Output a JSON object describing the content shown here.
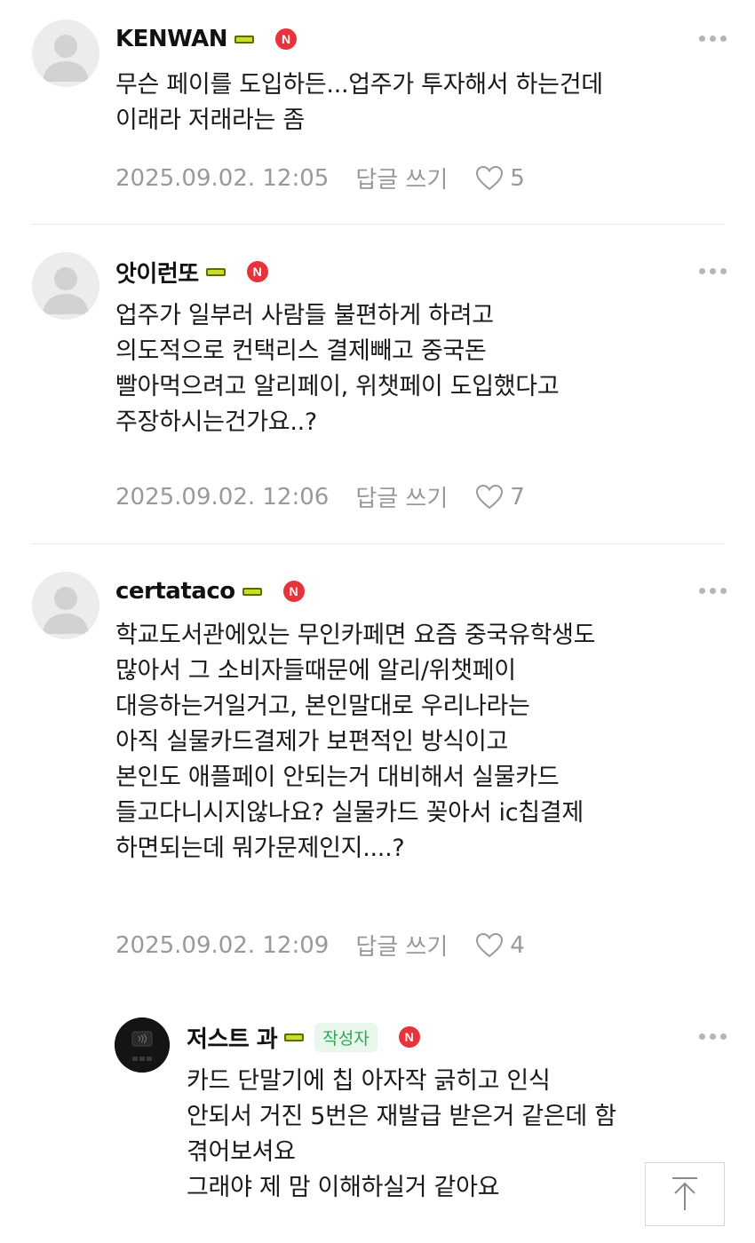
{
  "comments": [
    {
      "author": "KENWAN",
      "badge_letter": "N",
      "text": "무슨 페이를 도입하든...업주가 투자해서 하는건데\n이래라 저래라는 좀",
      "date": "2025.09.02. 12:05",
      "reply_label": "답글 쓰기",
      "likes": "5"
    },
    {
      "author": "앗이런또",
      "badge_letter": "N",
      "text": "업주가 일부러 사람들 불편하게 하려고\n의도적으로 컨택리스 결제빼고 중국돈\n빨아먹으려고 알리페이, 위챗페이 도입했다고\n주장하시는건가요..?",
      "date": "2025.09.02. 12:06",
      "reply_label": "답글 쓰기",
      "likes": "7"
    },
    {
      "author": "certataco",
      "badge_letter": "N",
      "text": "학교도서관에있는 무인카페면 요즘 중국유학생도\n많아서 그 소비자들때문에 알리/위챗페이\n대응하는거일거고, 본인말대로 우리나라는\n아직 실물카드결제가 보편적인 방식이고\n본인도 애플페이 안되는거 대비해서 실물카드\n들고다니시지않나요? 실물카드 꽂아서 ic칩결제\n하면되는데 뭐가문제인지....?",
      "date": "2025.09.02. 12:09",
      "reply_label": "답글 쓰기",
      "likes": "4"
    }
  ],
  "reply": {
    "author": "저스트 과",
    "author_tag": "작성자",
    "badge_letter": "N",
    "text": "카드 단말기에 칩 아자작 긁히고 인식\n안되서 거진 5번은 재발급 받은거 같은데 함\n겪어보셔요\n그래야 제 맘 이해하실거 같아요"
  },
  "icons": {
    "more": "more-dots-icon",
    "like": "heart-icon",
    "top": "arrow-up-icon"
  },
  "colors": {
    "author_badge": "#2fa656",
    "n_badge": "#e8323c",
    "meta_text": "#999999"
  }
}
